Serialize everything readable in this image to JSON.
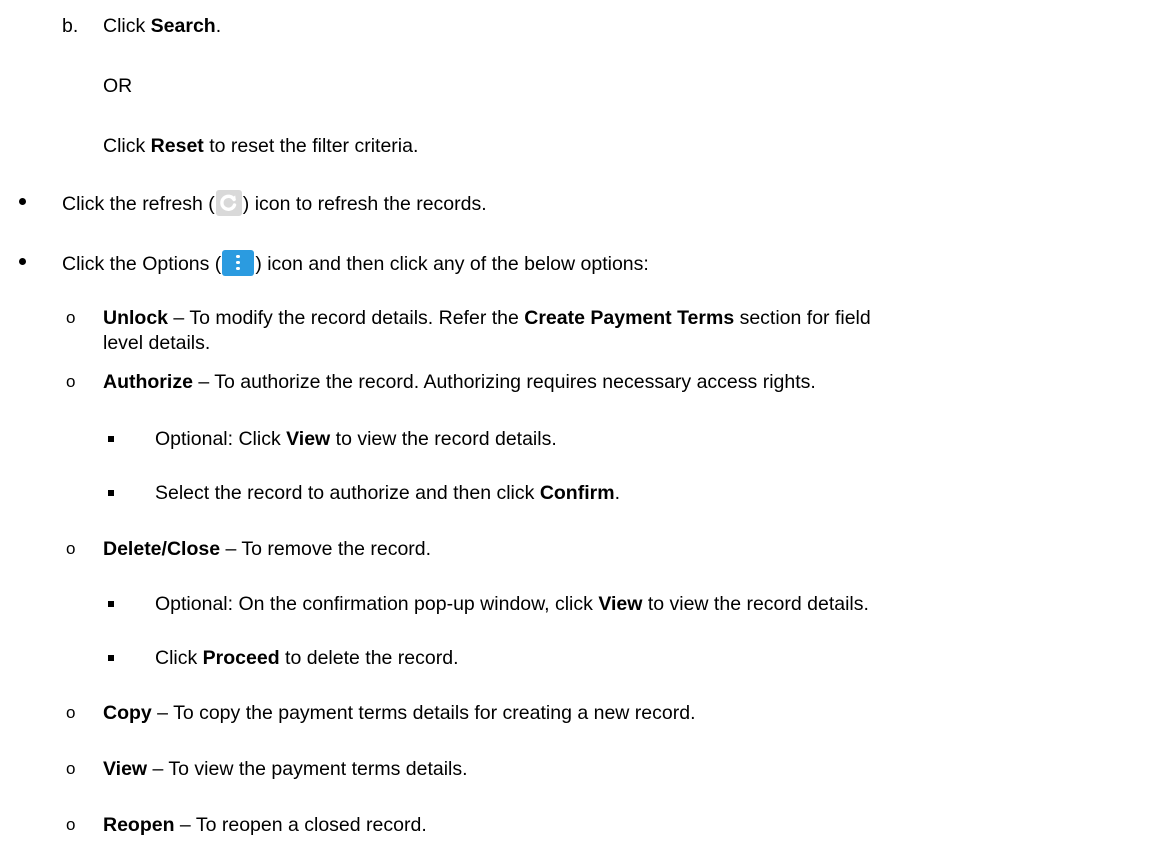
{
  "step_b": {
    "marker": "b.",
    "lead": "Click ",
    "bold": "Search",
    "tail": "."
  },
  "or_text": "OR",
  "reset_line": {
    "lead": "Click ",
    "bold": "Reset",
    "tail": " to reset the filter criteria."
  },
  "refresh_line": {
    "lead": "Click the refresh (",
    "icon": "refresh-icon",
    "tail": ") icon to refresh the records."
  },
  "options_line": {
    "lead": "Click the Options (",
    "icon": "kebab-options-icon",
    "tail": ") icon and then click any of the below options:"
  },
  "options": [
    {
      "bold": "Unlock",
      "text": " – To modify the record details. Refer the ",
      "bold2": "Create Payment Terms",
      "text2": " section for field",
      "cont": "level details."
    },
    {
      "bold": "Authorize",
      "text": " – To authorize the record. Authorizing requires necessary access rights.",
      "sub": [
        {
          "lead": "Optional: Click ",
          "bold": "View",
          "tail": " to view the record details."
        },
        {
          "lead": "Select the record to authorize and then click ",
          "bold": "Confirm",
          "tail": "."
        }
      ]
    },
    {
      "bold": "Delete/Close",
      "text": " – To remove the record.",
      "sub": [
        {
          "lead": "Optional: On the confirmation pop-up window, click ",
          "bold": "View",
          "tail": " to view the record details."
        },
        {
          "lead": "Click ",
          "bold": "Proceed",
          "tail": " to delete the record."
        }
      ]
    },
    {
      "bold": "Copy",
      "text": " – To copy the payment terms details for creating a new record."
    },
    {
      "bold": "View",
      "text": " – To view the payment terms details."
    },
    {
      "bold": "Reopen",
      "text": " – To reopen a closed record."
    }
  ],
  "colors": {
    "text": "#000000",
    "refresh_icon_bg": "#d9d9d9",
    "options_icon_bg": "#2b9be0"
  }
}
